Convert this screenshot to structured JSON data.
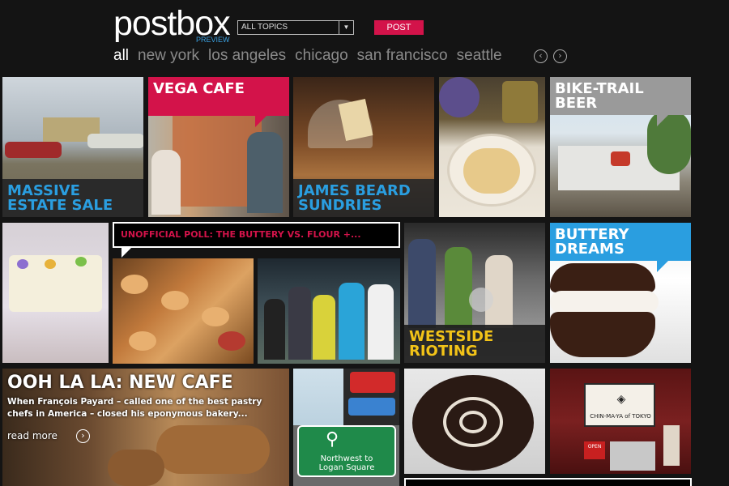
{
  "header": {
    "logo": "postbox",
    "preview": "PREVIEW",
    "topics": "ALL TOPICS",
    "post": "POST"
  },
  "nav": [
    "all",
    "new york",
    "los angeles",
    "chicago",
    "san francisco",
    "seattle"
  ],
  "tiles": {
    "estate": "MASSIVE\nESTATE SALE",
    "vega": "VEGA CAFE",
    "james": "JAMES BEARD\nSUNDRIES",
    "bike": "BIKE-TRAIL\nBEER",
    "poll": "UNOFFICIAL POLL: THE BUTTERY VS. FLOUR +...",
    "buttery": "BUTTERY\nDREAMS",
    "westside": "WESTSIDE\nRIOTING",
    "cafe_title": "OOH LA LA: NEW CAFE",
    "cafe_desc": "When François Payard – called one of the best pastry chefs in America – closed his eponymous bakery...",
    "cafe_more": "read more",
    "sign_line1": "Northwest to",
    "sign_line2": "Logan Square",
    "shop_sign": "CHIN-MA-YA of TOKYO",
    "shop_open": "OPEN"
  }
}
